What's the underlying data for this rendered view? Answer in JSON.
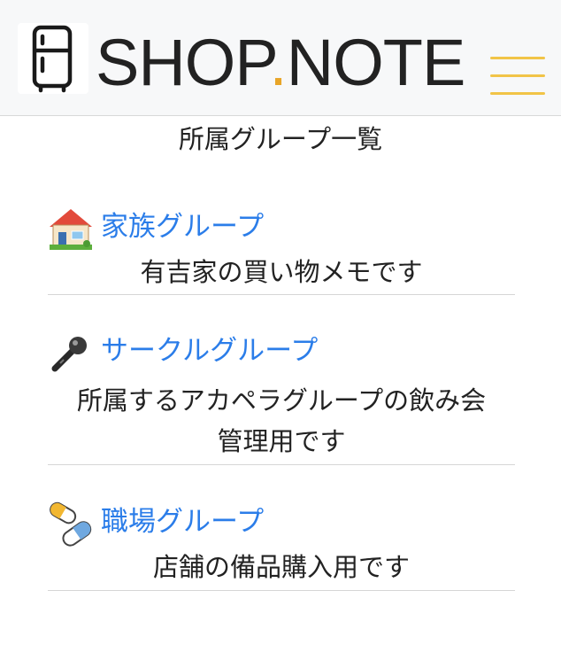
{
  "header": {
    "brand_main": "SHOP",
    "brand_dot": ".",
    "brand_tail": "NOTE",
    "logo_icon": "refrigerator-icon",
    "menu_icon": "hamburger-icon",
    "accent_color": "#e8a528",
    "menu_color": "#f1c447"
  },
  "page": {
    "title": "所属グループ一覧"
  },
  "groups": [
    {
      "icon": "house-icon",
      "name": "家族グループ",
      "description": "有吉家の買い物メモです"
    },
    {
      "icon": "microphone-icon",
      "name": "サークルグループ",
      "description_line1": "所属するアカペラグループの飲み会",
      "description_line2": "管理用です"
    },
    {
      "icon": "pill-icon",
      "name": "職場グループ",
      "description": "店舗の備品購入用です"
    }
  ],
  "colors": {
    "link": "#2b7de9",
    "navbar_bg": "#f7f8f9"
  }
}
